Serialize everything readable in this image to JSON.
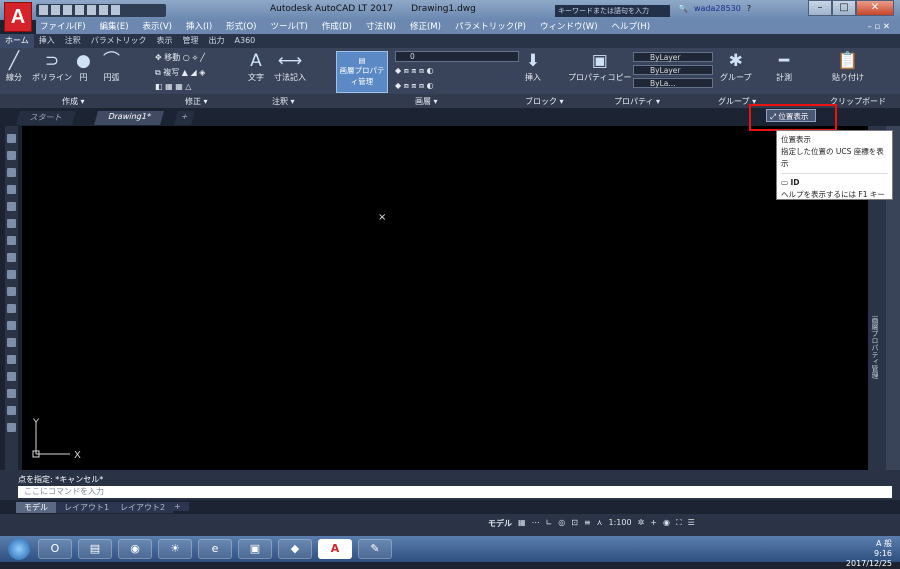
{
  "app": {
    "logo": "A",
    "title": "Autodesk AutoCAD LT 2017",
    "document": "Drawing1.dwg"
  },
  "search": {
    "placeholder": "キーワードまたは語句を入力"
  },
  "user": {
    "name": "wada28530"
  },
  "menu": [
    "ファイル(F)",
    "編集(E)",
    "表示(V)",
    "挿入(I)",
    "形式(O)",
    "ツール(T)",
    "作成(D)",
    "寸法(N)",
    "修正(M)",
    "パラメトリック(P)",
    "ウィンドウ(W)",
    "ヘルプ(H)"
  ],
  "ribbon_tabs": [
    "ホーム",
    "挿入",
    "注釈",
    "パラメトリック",
    "表示",
    "管理",
    "出力",
    "A360"
  ],
  "ribbon": {
    "line": "線分",
    "polyline": "ポリライン",
    "circle": "円",
    "arc": "円弧",
    "move": "移動",
    "copy": "複写",
    "text": "文字",
    "dim": "寸法記入",
    "layer_props": "画層プロパティ管理",
    "layer_value": "0",
    "insert": "挿入",
    "match_props": "プロパティコピー",
    "bylayer1": "ByLayer",
    "bylayer2": "ByLayer",
    "bylayer3": "ByLa...",
    "group": "グループ",
    "measure": "計測",
    "paste": "貼り付け",
    "panels": {
      "draw": "作成 ▾",
      "modify": "修正 ▾",
      "annotation": "注釈 ▾",
      "layers": "画層 ▾",
      "block": "ブロック ▾",
      "properties": "プロパティ ▾",
      "groups": "グループ ▾",
      "clipboard": "クリップボード"
    }
  },
  "doc_tabs": {
    "start": "スタート",
    "drawing": "Drawing1*"
  },
  "canvas": {
    "ucs_x": "X",
    "ucs_y": "Y",
    "cursor": "×"
  },
  "right_panel": {
    "label": "画層プロパティ管理"
  },
  "command": {
    "history": "点を指定: *キャンセル*",
    "placeholder": "ここにコマンドを入力"
  },
  "layout_tabs": [
    "モデル",
    "レイアウト1",
    "レイアウト2"
  ],
  "status": {
    "model": "モデル",
    "scale": "1:100"
  },
  "tooltip": {
    "button": "位置表示",
    "title": "位置表示",
    "desc": "指定した位置の UCS 座標を表示",
    "id_label": "ID",
    "help": "ヘルプを表示するには F1 キー"
  },
  "tray": {
    "time": "9:16",
    "date": "2017/12/25",
    "ime": "A 般"
  }
}
